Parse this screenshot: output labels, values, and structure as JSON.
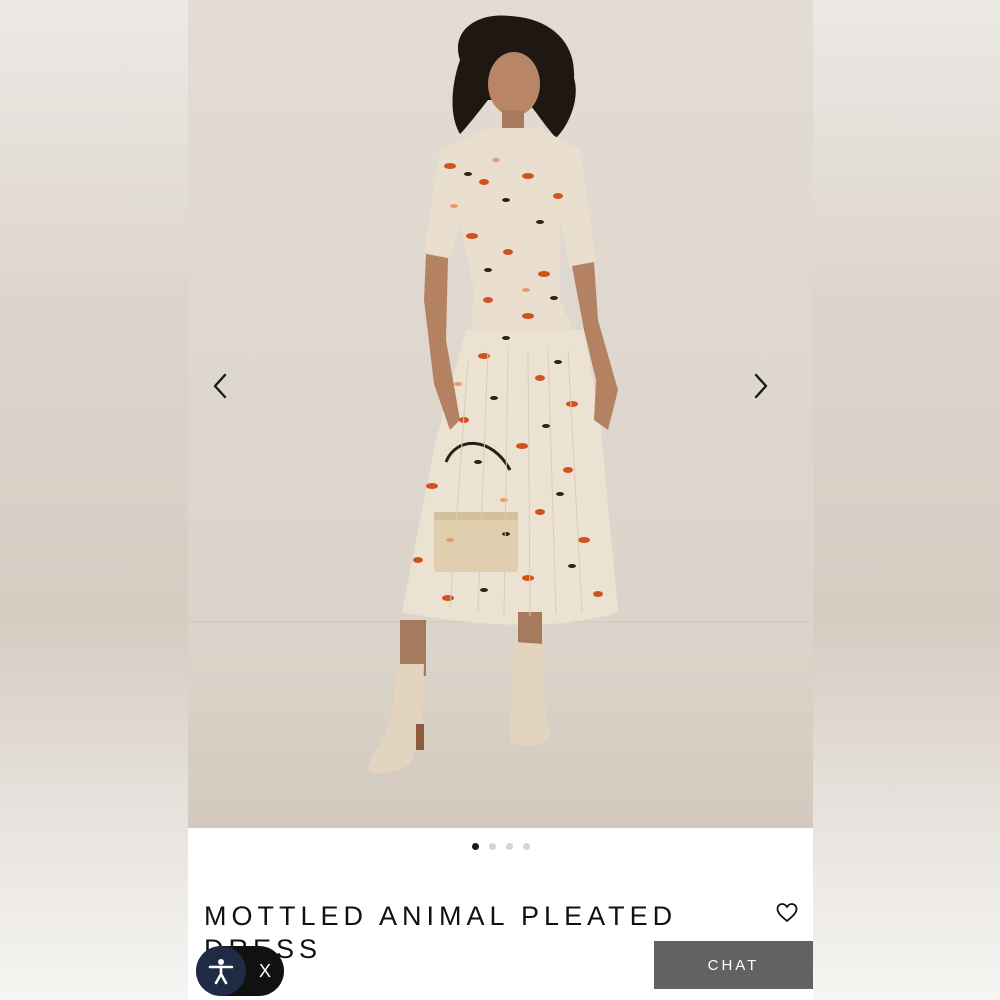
{
  "product": {
    "title": "MOTTLED ANIMAL PLEATED DRESS"
  },
  "carousel": {
    "slide_count": 4,
    "active_index": 0,
    "prev_icon": "chevron-left-icon",
    "next_icon": "chevron-right-icon"
  },
  "actions": {
    "wishlist_icon": "heart-outline-icon",
    "chat_label": "CHAT"
  },
  "accessibility_widget": {
    "icon": "accessibility-person-icon",
    "close_label": "X"
  },
  "colors": {
    "chat_bg": "#626262",
    "widget_bg": "#111111",
    "widget_icon_bg": "#1f2a44",
    "dot_active": "#1a1a1a",
    "dot_inactive": "#d4d4d4",
    "photo_backdrop": "#e6dfd7"
  }
}
